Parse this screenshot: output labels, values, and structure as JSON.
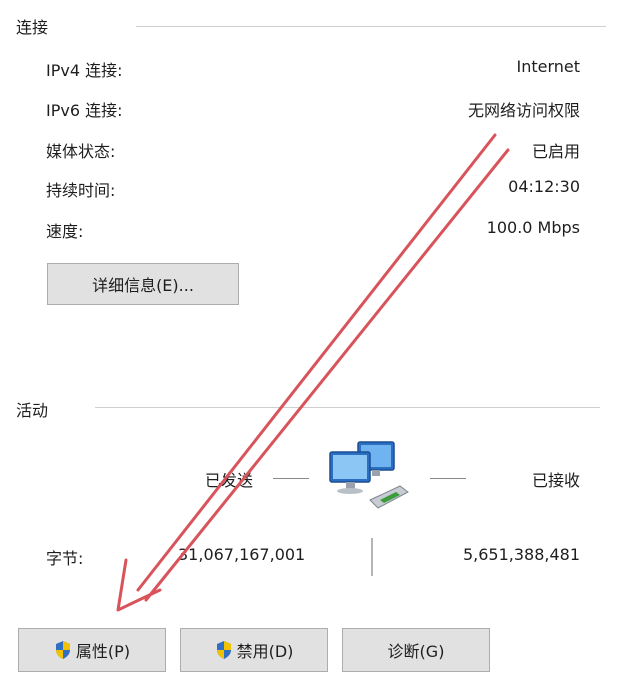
{
  "connection": {
    "title": "连接",
    "rows": [
      {
        "label": "IPv4 连接:",
        "value": "Internet"
      },
      {
        "label": "IPv6 连接:",
        "value": "无网络访问权限"
      },
      {
        "label": "媒体状态:",
        "value": "已启用"
      },
      {
        "label": "持续时间:",
        "value": "04:12:30"
      },
      {
        "label": "速度:",
        "value": "100.0 Mbps"
      }
    ],
    "details_button": "详细信息(E)..."
  },
  "activity": {
    "title": "活动",
    "sent_label": "已发送",
    "received_label": "已接收",
    "bytes_label": "字节:",
    "bytes_sent": "31,067,167,001",
    "bytes_received": "5,651,388,481"
  },
  "buttons": {
    "properties": "属性(P)",
    "disable": "禁用(D)",
    "diagnose": "诊断(G)"
  },
  "icons": {
    "network": "network-computers-icon",
    "shield": "uac-shield-icon"
  },
  "colors": {
    "annotation_arrow": "#d9535b"
  }
}
